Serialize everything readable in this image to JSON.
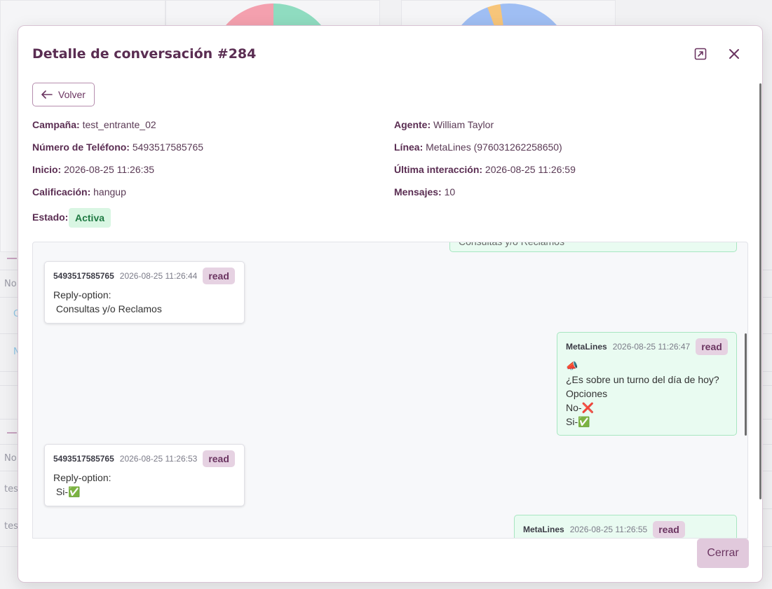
{
  "modal": {
    "title": "Detalle de conversación #284",
    "back_label": "Volver",
    "close_label": "Cerrar"
  },
  "details": {
    "campaign_label": "Campaña:",
    "campaign_value": "test_entrante_02",
    "agent_label": "Agente:",
    "agent_value": "William Taylor",
    "phone_label": "Número de Teléfono:",
    "phone_value": "5493517585765",
    "line_label": "Línea:",
    "line_value": "MetaLines (976031262258650)",
    "start_label": "Inicio:",
    "start_value": "2026-08-25 11:26:35",
    "last_label": "Última interacción:",
    "last_value": "2026-08-25 11:26:59",
    "rating_label": "Calificación:",
    "rating_value": "hangup",
    "messages_label": "Mensajes:",
    "messages_value": "10",
    "status_label": "Estado:",
    "status_value": "Activa"
  },
  "messages": [
    {
      "sender": "",
      "time": "",
      "status": "",
      "text": "Consultas y/o Reclamos"
    },
    {
      "sender": "5493517585765",
      "time": "2026-08-25 11:26:44",
      "status": "read",
      "text": "Reply-option:\n Consultas y/o Reclamos"
    },
    {
      "sender": "MetaLines",
      "time": "2026-08-25 11:26:47",
      "status": "read",
      "text": "📣\n¿Es sobre un turno del día de hoy?\nOpciones\nNo-❌\nSi-✅"
    },
    {
      "sender": "5493517585765",
      "time": "2026-08-25 11:26:53",
      "status": "read",
      "text": "Reply-option:\n Si-✅"
    },
    {
      "sender": "MetaLines",
      "time": "2026-08-25 11:26:55",
      "status": "read",
      "text": ""
    }
  ],
  "background": {
    "row_labels": [
      "No",
      "C",
      "N",
      "No",
      "tes",
      "tes"
    ]
  },
  "colors": {
    "accent": "#6b3561",
    "active_bg": "#d9f6e3",
    "active_fg": "#1f7a43",
    "out_bubble": "#e9fbf1",
    "pie_pink": "#f4a0ae",
    "pie_green": "#8fdcc0",
    "pie_blue": "#9fbef3",
    "pie_orange": "#f7c57a"
  }
}
